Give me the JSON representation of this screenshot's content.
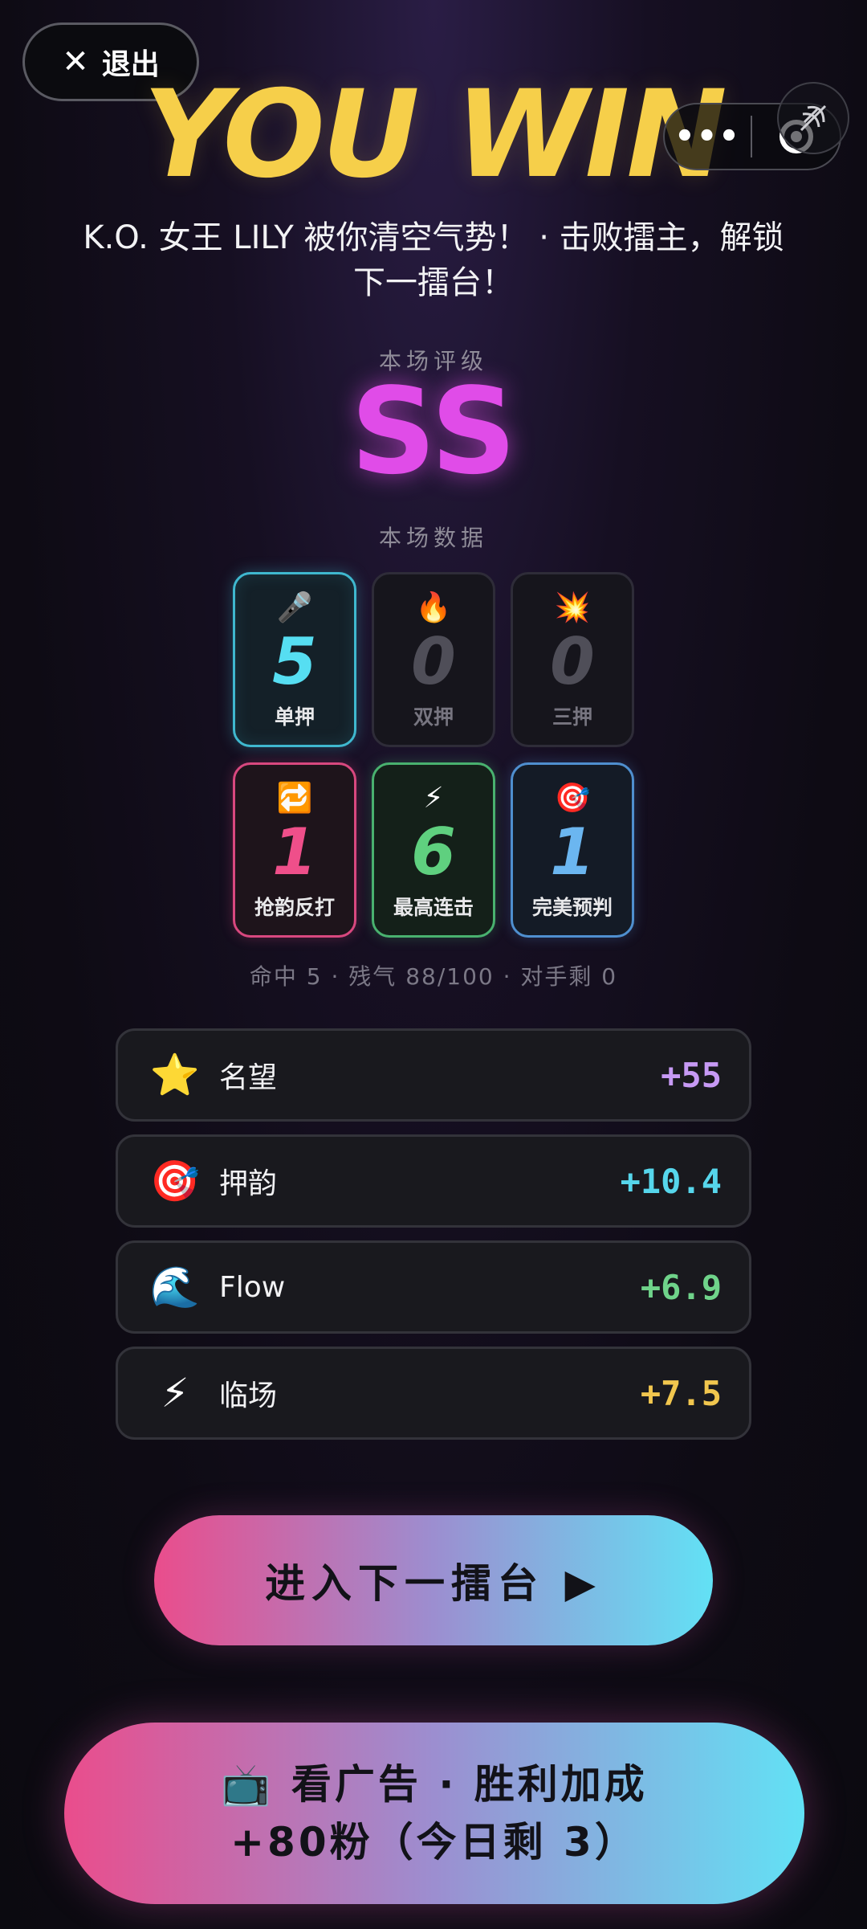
{
  "top_bar": {
    "exit_icon": "✕",
    "exit_label": "退出",
    "more_icon": "•••",
    "sound_icon": "sound-off-icon"
  },
  "title": "YOU WIN",
  "subtitle_line1": "K.O. 女王 LILY 被你清空气势！ · 击败擂主，解锁",
  "subtitle_line2": "下一擂台！",
  "grade_label": "本场评级",
  "grade": "SS",
  "stats_label": "本场数据",
  "stats": [
    {
      "emoji": "🎤",
      "value": "5",
      "label": "单押"
    },
    {
      "emoji": "🔥",
      "value": "0",
      "label": "双押"
    },
    {
      "emoji": "💥",
      "value": "0",
      "label": "三押"
    },
    {
      "emoji": "🔁",
      "value": "1",
      "label": "抢韵反打"
    },
    {
      "emoji": "⚡",
      "value": "6",
      "label": "最高连击"
    },
    {
      "emoji": "🎯",
      "value": "1",
      "label": "完美预判"
    }
  ],
  "summary": "命中 5 · 残气 88/100 · 对手剩 0",
  "rewards": [
    {
      "icon": "⭐",
      "name": "名望",
      "value": "+55",
      "color": "#c79af5"
    },
    {
      "icon": "🎯",
      "name": "押韵",
      "value": "+10.4",
      "color": "#56d6ec"
    },
    {
      "icon": "🌊",
      "name": "Flow",
      "value": "+6.9",
      "color": "#6fd38a"
    },
    {
      "icon": "⚡",
      "name": "临场",
      "value": "+7.5",
      "color": "#f1c64e"
    }
  ],
  "next_button": "进入下一擂台 ▶",
  "ad_button_line1": "📺 看广告 · 胜利加成",
  "ad_button_line2": "+80粉（今日剩 3）"
}
